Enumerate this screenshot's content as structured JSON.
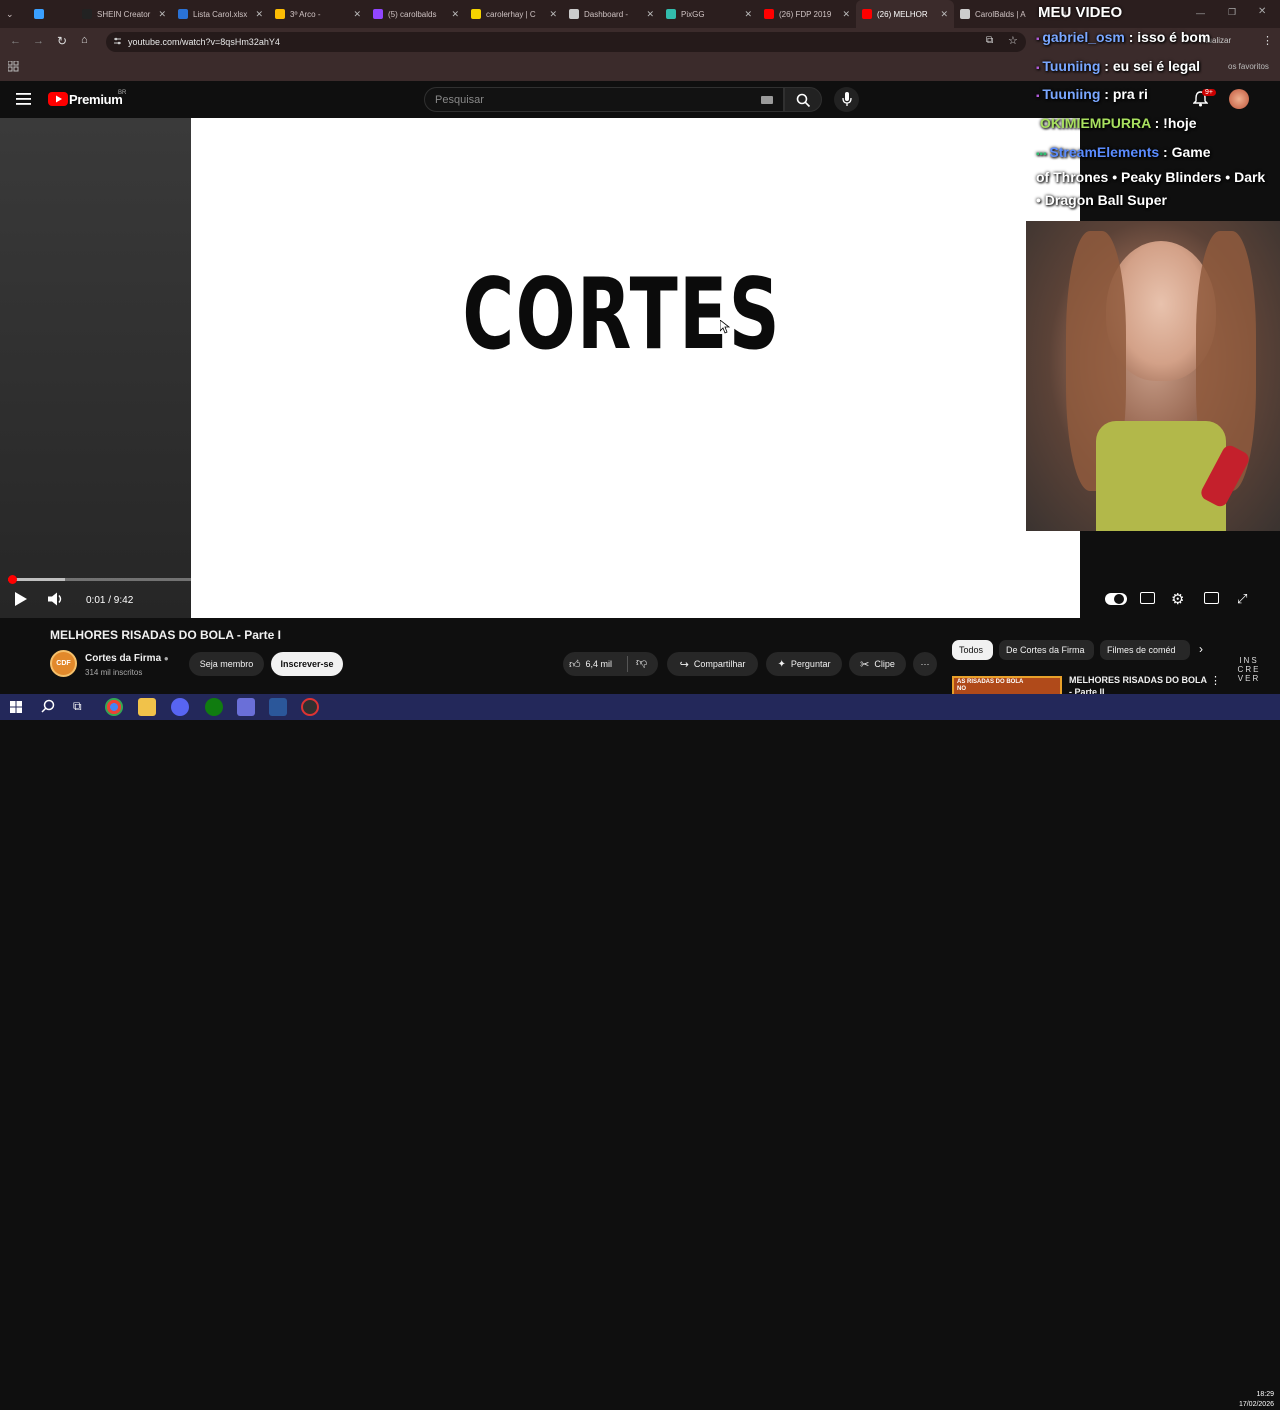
{
  "browser": {
    "tabs": [
      {
        "label": "",
        "color": "#3aa0ff"
      },
      {
        "label": "SHEIN Creator",
        "color": "#222222"
      },
      {
        "label": "Lista Carol.xlsx",
        "color": "#2a72d6"
      },
      {
        "label": "3º Arco -",
        "color": "#fbbc04"
      },
      {
        "label": "(5) carolbalds",
        "color": "#9146ff"
      },
      {
        "label": "carolerhay | C",
        "color": "#f5d400"
      },
      {
        "label": "Dashboard - ",
        "color": "#cccccc"
      },
      {
        "label": "PixGG",
        "color": "#32bcad"
      },
      {
        "label": "(26) FDP 2019",
        "color": "#ff0000"
      },
      {
        "label": "(26) MELHOR",
        "color": "#ff0000"
      },
      {
        "label": "CarolBalds | A",
        "color": "#cccccc"
      }
    ],
    "url": "youtube.com/watch?v=8qsHm32ahY4",
    "bookmarks_hint": "os favoritos",
    "update_label": "Atualizar"
  },
  "youtube": {
    "logo_label": "Premium",
    "logo_region": "BR",
    "search_placeholder": "Pesquisar",
    "notif_count": "9+"
  },
  "player": {
    "video_text": "CORTES",
    "time_current": "0:01",
    "time_total": "9:42",
    "time_display": "0:01 / 9:42",
    "progress_fraction": 0.002,
    "buffer_fraction": 0.054,
    "endcard_text": "INS CRE VER",
    "accent": "#ff0000"
  },
  "video": {
    "title": "MELHORES RISADAS DO BOLA - Parte I",
    "channel": "Cortes da Firma",
    "channel_initials": "CDF",
    "subscribers": "314 mil inscritos",
    "member_label": "Seja membro",
    "subscribe_label": "Inscrever-se",
    "likes": "6,4 mil",
    "share_label": "Compartilhar",
    "ask_label": "Perguntar",
    "clip_label": "Clipe",
    "more_label": "···"
  },
  "related": {
    "chips": [
      "Todos",
      "De Cortes da Firma",
      "Filmes de coméd"
    ],
    "first_title": "MELHORES RISADAS DO BOLA - Parte II",
    "thumb_text": "AS RISADAS DO BOLA NO"
  },
  "overlay": {
    "header": "MEU VIDEO",
    "chat": [
      {
        "user": "gabriel_osm",
        "message": " isso é bom",
        "user_color": "#7aa7ff"
      },
      {
        "user": "Tuuniing",
        "message": " eu sei é legal",
        "user_color": "#7aa7ff"
      },
      {
        "user": "Tuuniing",
        "message": " pra ri",
        "user_color": "#7aa7ff"
      },
      {
        "user": "OKIMIEMPURRA",
        "message": " !hoje",
        "user_color": "#a8e05f"
      },
      {
        "user": "StreamElements",
        "message": " Game",
        "user_color": "#5b8cff"
      }
    ],
    "chat_wrap_1": "of Thrones • Peaky Blinders • Dark",
    "chat_wrap_2": "• Dragon Ball Super"
  },
  "taskbar": {
    "time": "18:29",
    "date": "17/02/2026"
  }
}
